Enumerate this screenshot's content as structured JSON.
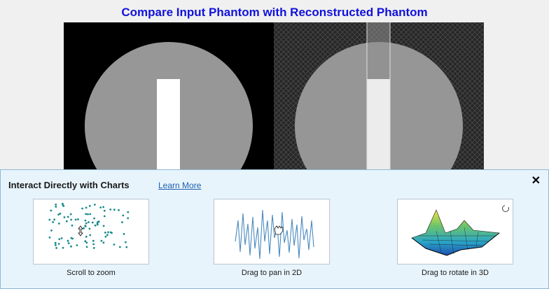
{
  "figure": {
    "title": "Compare Input Phantom with Reconstructed Phantom"
  },
  "tip_panel": {
    "header": "Interact Directly with Charts",
    "learn_more": "Learn More",
    "close_glyph": "✕",
    "cards": [
      {
        "caption": "Scroll to zoom",
        "icon": "scatter-zoom-illustration"
      },
      {
        "caption": "Drag to pan in 2D",
        "icon": "line-pan-illustration"
      },
      {
        "caption": "Drag to rotate in 3D",
        "icon": "surface-rotate-illustration"
      }
    ]
  },
  "colors": {
    "title": "#1111dd",
    "panel_bg": "#e8f4fc",
    "link": "#1c5fb0",
    "scatter": "#1a8a8a",
    "line": "#4a8ac0"
  }
}
